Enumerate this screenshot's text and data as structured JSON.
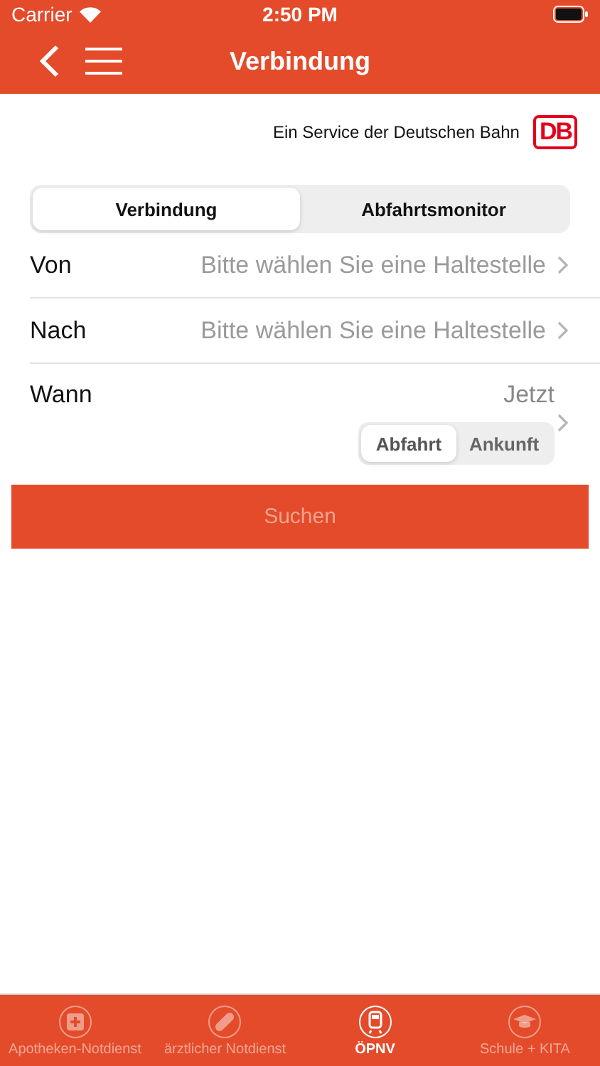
{
  "status_bar": {
    "carrier": "Carrier",
    "time": "2:50 PM"
  },
  "nav_bar": {
    "title": "Verbindung"
  },
  "service": {
    "text": "Ein Service der Deutschen Bahn",
    "logo": "DB"
  },
  "segments": [
    {
      "label": "Verbindung",
      "selected": true
    },
    {
      "label": "Abfahrtsmonitor",
      "selected": false
    }
  ],
  "rows": [
    {
      "label": "Von",
      "placeholder": "Bitte wählen Sie eine Haltestelle"
    },
    {
      "label": "Nach",
      "placeholder": "Bitte wählen Sie eine Haltestelle"
    }
  ],
  "when": {
    "label": "Wann",
    "value": "Jetzt",
    "options": [
      {
        "label": "Abfahrt",
        "selected": true
      },
      {
        "label": "Ankunft",
        "selected": false
      }
    ]
  },
  "search_button": {
    "label": "Suchen",
    "disabled": true
  },
  "tab_bar": [
    {
      "label": "Apotheken-Notdienst",
      "kind": "pharmacy",
      "selected": false
    },
    {
      "label": "ärztlicher Notdienst",
      "kind": "bandage",
      "selected": false
    },
    {
      "label": "ÖPNV",
      "kind": "train",
      "selected": true
    },
    {
      "label": "Schule + KITA",
      "kind": "school",
      "selected": false
    }
  ]
}
